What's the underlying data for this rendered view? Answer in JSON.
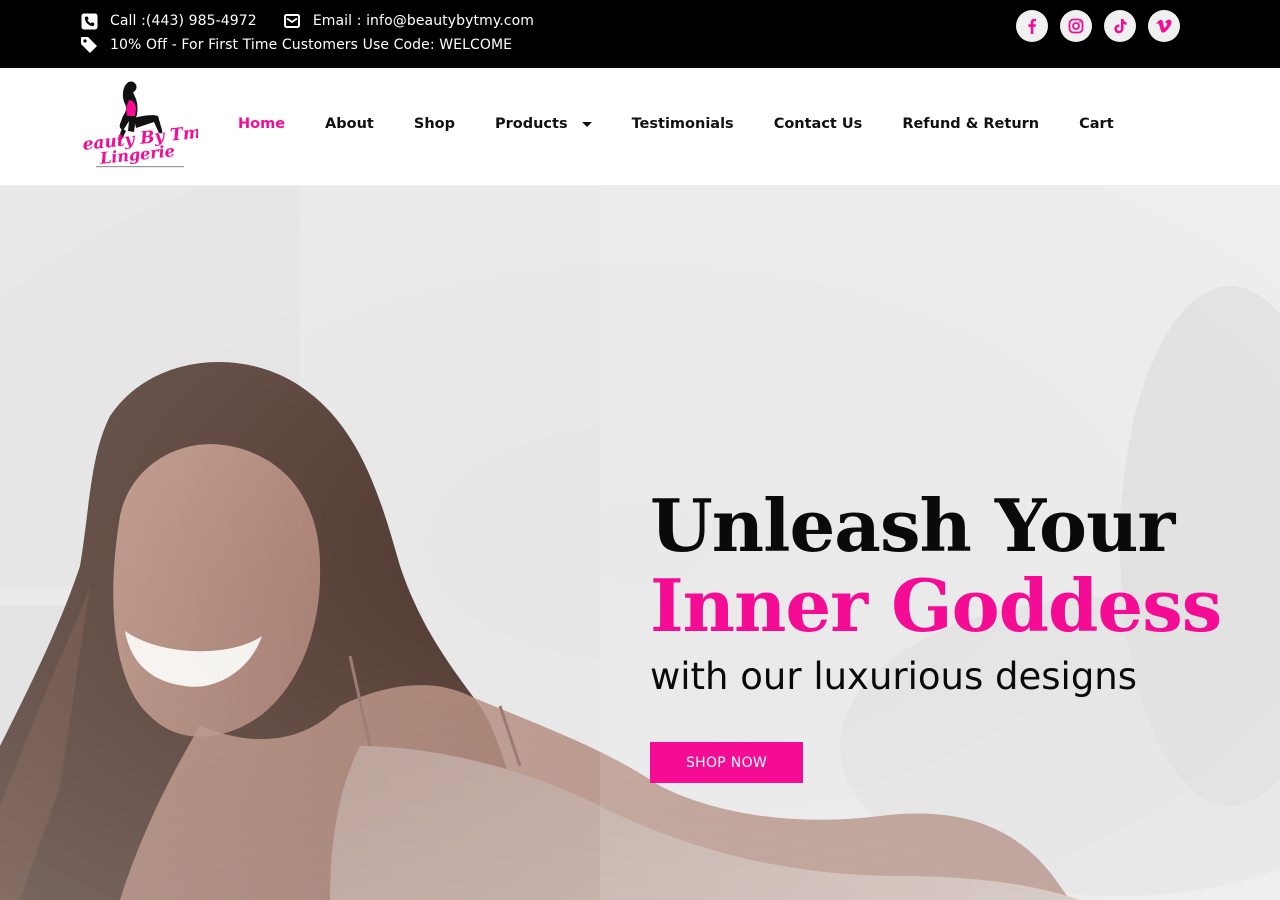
{
  "topbar": {
    "phone": "Call :(443) 985-4972",
    "email": "Email : info@beautybytmy.com",
    "promo": "10% Off - For First Time Customers Use Code: WELCOME",
    "socials": [
      {
        "name": "facebook-icon"
      },
      {
        "name": "instagram-icon"
      },
      {
        "name": "tiktok-icon"
      },
      {
        "name": "vimeo-icon"
      }
    ]
  },
  "logo": {
    "line1": "Beauty By Tmy",
    "line2": "Lingerie"
  },
  "nav": {
    "items": [
      {
        "label": "Home",
        "active": true
      },
      {
        "label": "About"
      },
      {
        "label": "Shop"
      },
      {
        "label": "Products",
        "dropdown": true
      },
      {
        "label": "Testimonials"
      },
      {
        "label": "Contact Us"
      },
      {
        "label": "Refund & Return"
      },
      {
        "label": "Cart"
      }
    ]
  },
  "hero": {
    "title_line1": "Unleash Your",
    "title_line2": "Inner Goddess",
    "subtitle": "with our luxurious designs",
    "cta": "SHOP NOW"
  },
  "colors": {
    "accent": "#f50c94",
    "topbar_bg": "#000000",
    "text": "#0a0a0a"
  }
}
